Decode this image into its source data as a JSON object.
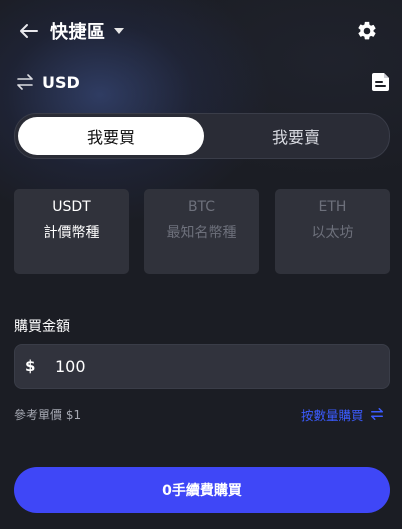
{
  "header": {
    "title": "快捷區",
    "icons": {
      "back": "arrow-left-icon",
      "dropdown": "caret-down-icon",
      "settings": "gear-icon"
    }
  },
  "currency": {
    "code": "USD",
    "icons": {
      "swap": "swap-arrows-icon",
      "orders": "document-icon"
    }
  },
  "trade_toggle": {
    "buy_label": "我要買",
    "sell_label": "我要賣",
    "selected": "buy"
  },
  "coins": [
    {
      "symbol": "USDT",
      "name": "計價幣種",
      "selected": true
    },
    {
      "symbol": "BTC",
      "name": "最知名幣種",
      "selected": false
    },
    {
      "symbol": "ETH",
      "name": "以太坊",
      "selected": false
    }
  ],
  "amount": {
    "label": "購買金額",
    "currency_symbol": "$",
    "value": "100"
  },
  "reference_price": "參考單價 $1",
  "buy_by_quantity": "按數量購買",
  "submit_label": "0手續費購買",
  "colors": {
    "accent": "#3f47f7",
    "link": "#3b5bff",
    "background": "#1b1d24"
  }
}
